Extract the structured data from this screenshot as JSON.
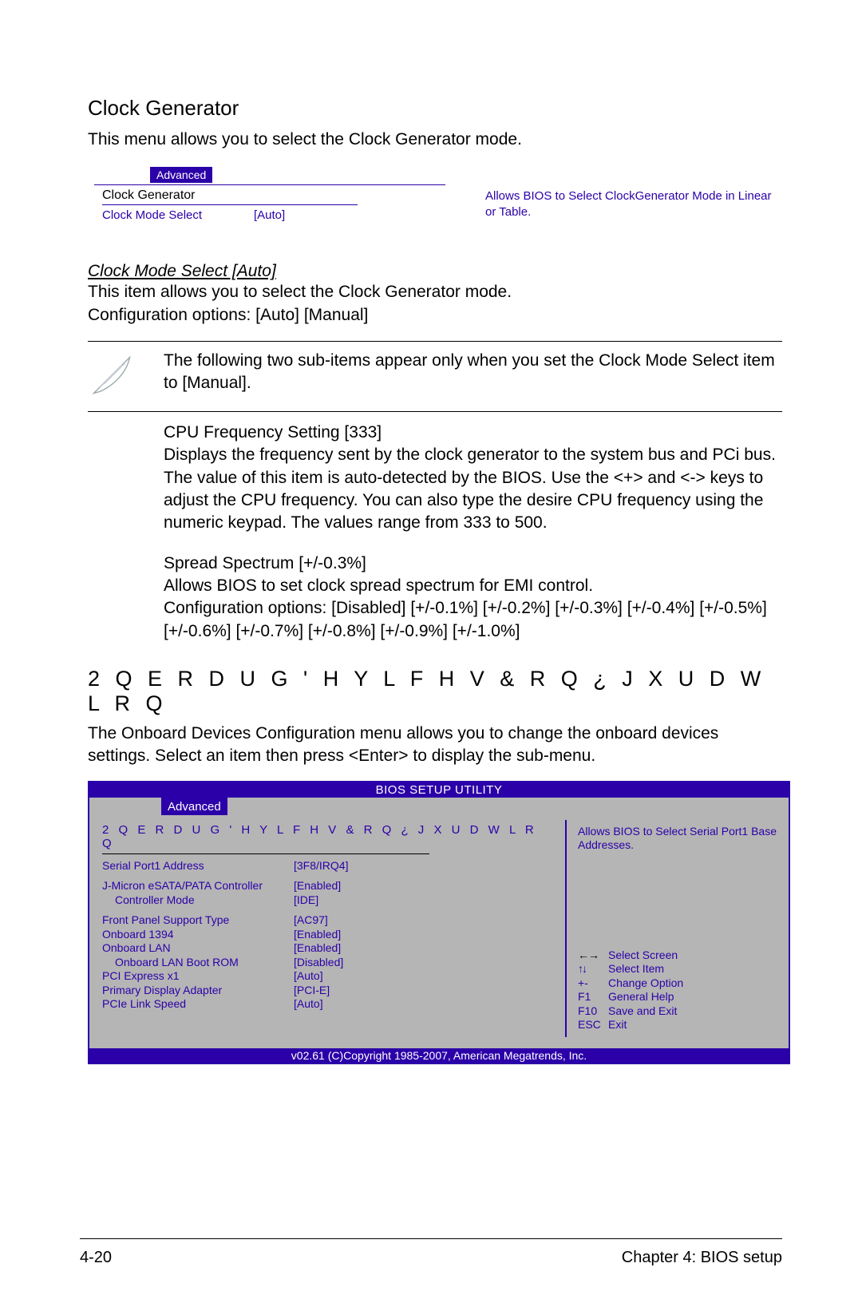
{
  "section1": {
    "title": "Clock Generator",
    "intro": "This menu allows you to select the Clock Generator mode."
  },
  "bios1": {
    "tab": "Advanced",
    "panel_title": "Clock Generator",
    "item_label": "Clock Mode Select",
    "item_value": "[Auto]",
    "help": "Allows BIOS to Select ClockGenerator Mode in Linear or Table."
  },
  "clock_mode": {
    "heading": "Clock Mode Select [Auto]",
    "line1": "This item allows you to select the Clock Generator mode.",
    "line2": "Configuration options: [Auto] [Manual]"
  },
  "note": "The following two sub-items appear only when you set the Clock Mode Select item to [Manual].",
  "cpu_freq": {
    "heading": "CPU Frequency Setting [333]",
    "body": "Displays the frequency sent by the clock generator to the system bus and PCi bus. The value of this item is auto-detected by the BIOS. Use the <+> and <-> keys to adjust the CPU frequency. You can also type the desire CPU frequency using the numeric keypad. The values range from 333 to 500."
  },
  "spread": {
    "heading": "Spread Spectrum [+/-0.3%]",
    "line1": "Allows BIOS to set clock spread spectrum for EMI control.",
    "line2": "Configuration options: [Disabled] [+/-0.1%] [+/-0.2%] [+/-0.3%] [+/-0.4%] [+/-0.5%] [+/-0.6%] [+/-0.7%] [+/-0.8%] [+/-0.9%] [+/-1.0%]"
  },
  "section2": {
    "heading_cipher": "2 Q E R D U G   ' H Y L F H V   & R Q ¿ J X U D W L R Q",
    "intro": "The Onboard Devices Configuration menu allows you to change the onboard devices settings. Select an item then press <Enter> to display the sub-menu."
  },
  "bios2": {
    "title": "BIOS SETUP UTILITY",
    "tab": "Advanced",
    "panel_title_cipher": "2 Q E R D U G   ' H Y L F H V   & R Q ¿ J X U D W L R Q",
    "items": [
      {
        "label": "Serial Port1 Address",
        "value": "[3F8/IRQ4]"
      },
      {
        "label": "J-Micron eSATA/PATA Controller",
        "value": "[Enabled]"
      },
      {
        "label": "Controller Mode",
        "value": "[IDE]",
        "sub": true
      },
      {
        "label": "Front Panel Support Type",
        "value": "[AC97]"
      },
      {
        "label": "Onboard 1394",
        "value": "[Enabled]"
      },
      {
        "label": "Onboard LAN",
        "value": "[Enabled]"
      },
      {
        "label": "Onboard LAN Boot ROM",
        "value": "[Disabled]",
        "sub": true
      },
      {
        "label": "PCI Express x1",
        "value": "[Auto]"
      },
      {
        "label": "Primary Display Adapter",
        "value": "[PCI-E]"
      },
      {
        "label": "PCIe Link Speed",
        "value": "[Auto]"
      }
    ],
    "help": "Allows BIOS to Select Serial Port1 Base Addresses.",
    "nav": {
      "select_screen": "Select Screen",
      "select_item": "Select Item",
      "change_option": "Change Option",
      "general_help": "General Help",
      "save_exit": "Save and Exit",
      "exit": "Exit",
      "k_pm": "+-",
      "k_f1": "F1",
      "k_f10": "F10",
      "k_esc": "ESC"
    },
    "copyright": "v02.61 (C)Copyright 1985-2007, American Megatrends, Inc."
  },
  "footer": {
    "left": "4-20",
    "right": "Chapter 4: BIOS setup"
  }
}
